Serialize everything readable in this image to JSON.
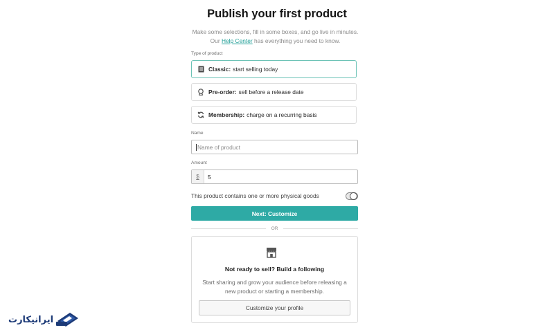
{
  "header": {
    "title": "Publish your first product",
    "subtitle_prefix": "Make some selections, fill in some boxes, and go live in minutes. Our ",
    "help_link": "Help Center",
    "subtitle_suffix": " has everything you need to know."
  },
  "product_type": {
    "label": "Type of product",
    "options": [
      {
        "bold": "Classic:",
        "text": "start selling today",
        "icon": "document-icon",
        "selected": true
      },
      {
        "bold": "Pre-order:",
        "text": "sell before a release date",
        "icon": "badge-icon",
        "selected": false
      },
      {
        "bold": "Membership:",
        "text": "charge on a recurring basis",
        "icon": "refresh-icon",
        "selected": false
      }
    ]
  },
  "name_field": {
    "label": "Name",
    "placeholder": "Name of product"
  },
  "amount_field": {
    "label": "Amount",
    "prefix": "$",
    "value": "5"
  },
  "physical_toggle": {
    "label": "This product contains one or more physical goods",
    "on": false
  },
  "next_button": "Next: Customize",
  "or_divider": "OR",
  "following_card": {
    "icon": "store-icon",
    "title": "Not ready to sell? Build a following",
    "description": "Start sharing and grow your audience before releasing a new product or starting a membership.",
    "button": "Customize your profile"
  },
  "watermark": {
    "text": "ایرانیکارت",
    "icon": "card-logo-icon"
  },
  "colors": {
    "accent": "#2eaaa5",
    "selected_border": "#6cc3b6",
    "link": "#1e9e96",
    "logo": "#1c3a77"
  }
}
